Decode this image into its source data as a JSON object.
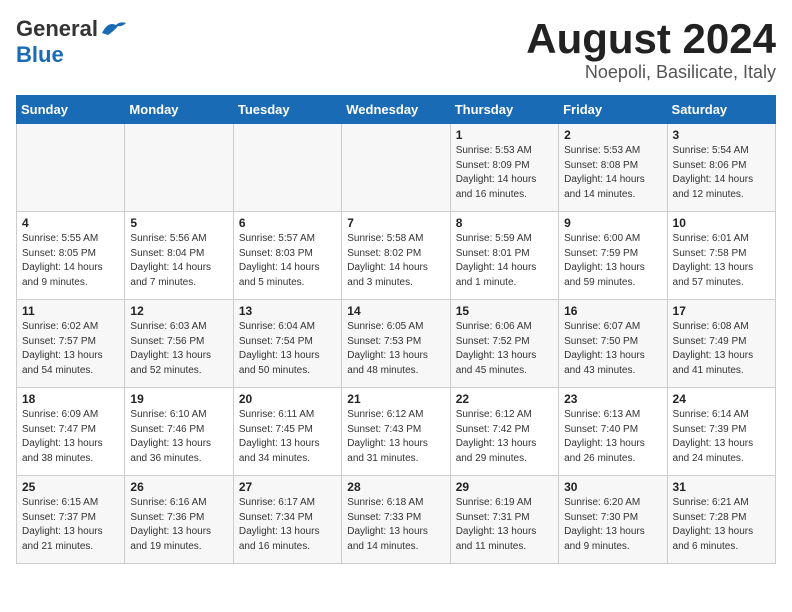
{
  "header": {
    "logo_general": "General",
    "logo_blue": "Blue",
    "month_title": "August 2024",
    "location": "Noepoli, Basilicate, Italy"
  },
  "weekdays": [
    "Sunday",
    "Monday",
    "Tuesday",
    "Wednesday",
    "Thursday",
    "Friday",
    "Saturday"
  ],
  "weeks": [
    [
      {
        "day": "",
        "detail": ""
      },
      {
        "day": "",
        "detail": ""
      },
      {
        "day": "",
        "detail": ""
      },
      {
        "day": "",
        "detail": ""
      },
      {
        "day": "1",
        "detail": "Sunrise: 5:53 AM\nSunset: 8:09 PM\nDaylight: 14 hours\nand 16 minutes."
      },
      {
        "day": "2",
        "detail": "Sunrise: 5:53 AM\nSunset: 8:08 PM\nDaylight: 14 hours\nand 14 minutes."
      },
      {
        "day": "3",
        "detail": "Sunrise: 5:54 AM\nSunset: 8:06 PM\nDaylight: 14 hours\nand 12 minutes."
      }
    ],
    [
      {
        "day": "4",
        "detail": "Sunrise: 5:55 AM\nSunset: 8:05 PM\nDaylight: 14 hours\nand 9 minutes."
      },
      {
        "day": "5",
        "detail": "Sunrise: 5:56 AM\nSunset: 8:04 PM\nDaylight: 14 hours\nand 7 minutes."
      },
      {
        "day": "6",
        "detail": "Sunrise: 5:57 AM\nSunset: 8:03 PM\nDaylight: 14 hours\nand 5 minutes."
      },
      {
        "day": "7",
        "detail": "Sunrise: 5:58 AM\nSunset: 8:02 PM\nDaylight: 14 hours\nand 3 minutes."
      },
      {
        "day": "8",
        "detail": "Sunrise: 5:59 AM\nSunset: 8:01 PM\nDaylight: 14 hours\nand 1 minute."
      },
      {
        "day": "9",
        "detail": "Sunrise: 6:00 AM\nSunset: 7:59 PM\nDaylight: 13 hours\nand 59 minutes."
      },
      {
        "day": "10",
        "detail": "Sunrise: 6:01 AM\nSunset: 7:58 PM\nDaylight: 13 hours\nand 57 minutes."
      }
    ],
    [
      {
        "day": "11",
        "detail": "Sunrise: 6:02 AM\nSunset: 7:57 PM\nDaylight: 13 hours\nand 54 minutes."
      },
      {
        "day": "12",
        "detail": "Sunrise: 6:03 AM\nSunset: 7:56 PM\nDaylight: 13 hours\nand 52 minutes."
      },
      {
        "day": "13",
        "detail": "Sunrise: 6:04 AM\nSunset: 7:54 PM\nDaylight: 13 hours\nand 50 minutes."
      },
      {
        "day": "14",
        "detail": "Sunrise: 6:05 AM\nSunset: 7:53 PM\nDaylight: 13 hours\nand 48 minutes."
      },
      {
        "day": "15",
        "detail": "Sunrise: 6:06 AM\nSunset: 7:52 PM\nDaylight: 13 hours\nand 45 minutes."
      },
      {
        "day": "16",
        "detail": "Sunrise: 6:07 AM\nSunset: 7:50 PM\nDaylight: 13 hours\nand 43 minutes."
      },
      {
        "day": "17",
        "detail": "Sunrise: 6:08 AM\nSunset: 7:49 PM\nDaylight: 13 hours\nand 41 minutes."
      }
    ],
    [
      {
        "day": "18",
        "detail": "Sunrise: 6:09 AM\nSunset: 7:47 PM\nDaylight: 13 hours\nand 38 minutes."
      },
      {
        "day": "19",
        "detail": "Sunrise: 6:10 AM\nSunset: 7:46 PM\nDaylight: 13 hours\nand 36 minutes."
      },
      {
        "day": "20",
        "detail": "Sunrise: 6:11 AM\nSunset: 7:45 PM\nDaylight: 13 hours\nand 34 minutes."
      },
      {
        "day": "21",
        "detail": "Sunrise: 6:12 AM\nSunset: 7:43 PM\nDaylight: 13 hours\nand 31 minutes."
      },
      {
        "day": "22",
        "detail": "Sunrise: 6:12 AM\nSunset: 7:42 PM\nDaylight: 13 hours\nand 29 minutes."
      },
      {
        "day": "23",
        "detail": "Sunrise: 6:13 AM\nSunset: 7:40 PM\nDaylight: 13 hours\nand 26 minutes."
      },
      {
        "day": "24",
        "detail": "Sunrise: 6:14 AM\nSunset: 7:39 PM\nDaylight: 13 hours\nand 24 minutes."
      }
    ],
    [
      {
        "day": "25",
        "detail": "Sunrise: 6:15 AM\nSunset: 7:37 PM\nDaylight: 13 hours\nand 21 minutes."
      },
      {
        "day": "26",
        "detail": "Sunrise: 6:16 AM\nSunset: 7:36 PM\nDaylight: 13 hours\nand 19 minutes."
      },
      {
        "day": "27",
        "detail": "Sunrise: 6:17 AM\nSunset: 7:34 PM\nDaylight: 13 hours\nand 16 minutes."
      },
      {
        "day": "28",
        "detail": "Sunrise: 6:18 AM\nSunset: 7:33 PM\nDaylight: 13 hours\nand 14 minutes."
      },
      {
        "day": "29",
        "detail": "Sunrise: 6:19 AM\nSunset: 7:31 PM\nDaylight: 13 hours\nand 11 minutes."
      },
      {
        "day": "30",
        "detail": "Sunrise: 6:20 AM\nSunset: 7:30 PM\nDaylight: 13 hours\nand 9 minutes."
      },
      {
        "day": "31",
        "detail": "Sunrise: 6:21 AM\nSunset: 7:28 PM\nDaylight: 13 hours\nand 6 minutes."
      }
    ]
  ]
}
